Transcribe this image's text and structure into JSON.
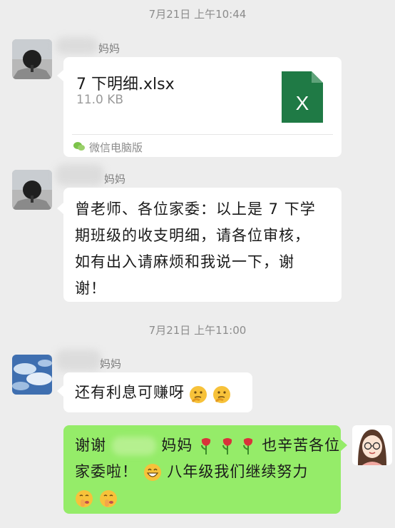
{
  "timestamps": [
    "7月21日 上午10:44",
    "7月21日 上午11:00"
  ],
  "messages": [
    {
      "sender": "妈妈",
      "type": "file",
      "file_name": "7 下明细.xlsx",
      "file_size": "11.0 KB",
      "file_icon_letter": "X",
      "source_app": "微信电脑版"
    },
    {
      "sender": "妈妈",
      "type": "text",
      "lines": [
        "曾老师、各位家委：以上是 7 下学",
        "期班级的收支明细，请各位审核，",
        "如有出入请麻烦和我说一下，谢",
        "谢！"
      ]
    },
    {
      "sender": "妈妈",
      "type": "text",
      "text": "还有利息可赚呀",
      "emojis": [
        "thinking-face",
        "thinking-face"
      ]
    },
    {
      "sender_self": true,
      "type": "text",
      "line1_a": "谢谢",
      "line1_b": "妈妈",
      "line1_c": "也辛苦各位",
      "flower_emojis": [
        "rose",
        "rose",
        "rose"
      ],
      "line2_a": "家委啦！",
      "line2_b": "八年级我们继续努力",
      "emojis": [
        "grinning-face",
        "shushing-face",
        "shushing-face"
      ]
    }
  ],
  "colors": {
    "background": "#ededed",
    "bubble_other": "#ffffff",
    "bubble_self": "#95ec69",
    "excel_green": "#1f7a45"
  }
}
